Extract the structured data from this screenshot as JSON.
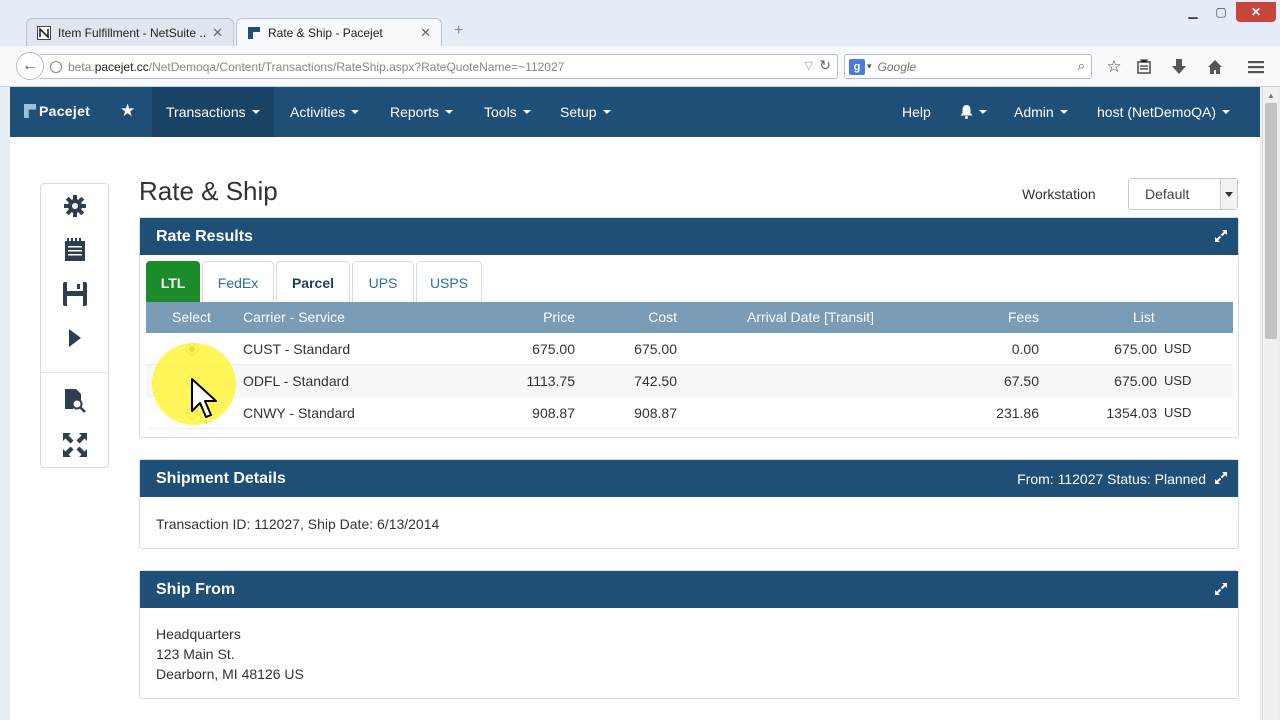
{
  "browser": {
    "tabs": [
      {
        "label": "Item Fulfillment - NetSuite ...",
        "active": false
      },
      {
        "label": "Rate & Ship - Pacejet",
        "active": true
      }
    ],
    "url_domain": "beta.pacejet.cc",
    "url_prefix": "beta.",
    "url_host": "pacejet.cc",
    "url_path": "/NetDemoqa/Content/Transactions/RateShip.aspx?RateQuoteName=~112027",
    "search_placeholder": "Google",
    "search_engine_icon": "google-icon"
  },
  "app": {
    "logo_text": "Pacejet",
    "menu": [
      {
        "label": "Transactions",
        "active": true
      },
      {
        "label": "Activities"
      },
      {
        "label": "Reports"
      },
      {
        "label": "Tools"
      },
      {
        "label": "Setup"
      }
    ],
    "right_menu": {
      "help": "Help",
      "admin": "Admin",
      "host": "host (NetDemoQA)"
    }
  },
  "page": {
    "title": "Rate & Ship",
    "workstation_label": "Workstation",
    "workstation_value": "Default"
  },
  "rate_results": {
    "title": "Rate Results",
    "tabs": [
      "LTL",
      "FedEx",
      "Parcel",
      "UPS",
      "USPS"
    ],
    "selected_tab": "LTL",
    "columns": {
      "select": "Select",
      "carrier": "Carrier - Service",
      "price": "Price",
      "cost": "Cost",
      "arrival": "Arrival Date [Transit]",
      "fees": "Fees",
      "list": "List"
    },
    "rows": [
      {
        "carrier": "CUST - Standard",
        "price": "675.00",
        "cost": "675.00",
        "arrival": "",
        "fees": "0.00",
        "list": "675.00",
        "currency": "USD",
        "selected": true
      },
      {
        "carrier": "ODFL - Standard",
        "price": "1113.75",
        "cost": "742.50",
        "arrival": "",
        "fees": "67.50",
        "list": "675.00",
        "currency": "USD",
        "selected": false
      },
      {
        "carrier": "CNWY - Standard",
        "price": "908.87",
        "cost": "908.87",
        "arrival": "",
        "fees": "231.86",
        "list": "1354.03",
        "currency": "USD",
        "selected": false
      }
    ]
  },
  "shipment_details": {
    "title": "Shipment Details",
    "status_text": "From: 112027 Status: Planned",
    "body": "Transaction ID: 112027, Ship Date: 6/13/2014"
  },
  "ship_from": {
    "title": "Ship From",
    "lines": [
      "Headquarters",
      "123 Main St.",
      "Dearborn, MI 48126 US"
    ]
  },
  "colors": {
    "header": "#1f4f77",
    "table_head": "#7a9cb7",
    "ltl_tab": "#1c8c2a",
    "cursor_highlight": "#fff43c"
  }
}
